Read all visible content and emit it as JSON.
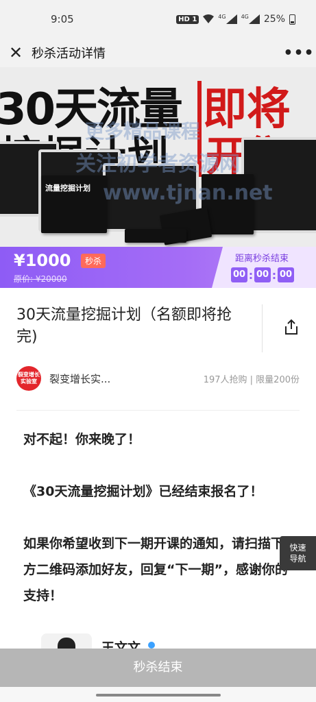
{
  "status": {
    "time": "9:05",
    "hd": "HD 1",
    "net": "4G",
    "net2": "4G",
    "battery": "25%"
  },
  "nav": {
    "title": "秒杀活动详情"
  },
  "banner": {
    "line1": "30天流量",
    "line2": "挖掘计划",
    "red1": "即将",
    "red2": "开售",
    "book_title": "流量挖掘计划",
    "watermark1": "更多精品课程",
    "watermark2": "关注初学者资源网",
    "watermark3": "www.tjnan.net"
  },
  "price": {
    "current": "¥1000",
    "badge": "秒杀",
    "original": "原价: ¥20000"
  },
  "countdown": {
    "label": "距离秒杀结束",
    "h": "00",
    "m": "00",
    "s": "00"
  },
  "product": {
    "title": "30天流量挖掘计划（名额即将抢完)"
  },
  "shop": {
    "logo_text": "裂变增长实验室",
    "name": "裂变增长实...",
    "sales": "197人抢购 | 限量200份"
  },
  "content": {
    "p1": "对不起！你来晚了！",
    "p2": "《30天流量挖掘计划》已经结束报名了！",
    "p3": "如果你希望收到下一期开课的通知，请扫描下方二维码添加好友，回复“下一期”，感谢你的支持！"
  },
  "quicknav": {
    "line1": "快速",
    "line2": "导航"
  },
  "author": {
    "name": "王文文"
  },
  "footer": {
    "label": "秒杀结束"
  },
  "colors": {
    "accent": "#8f5ef5",
    "badge": "#ff6a5a",
    "banner_red": "#d11a1a",
    "footer_bg": "#b6b6b6"
  }
}
